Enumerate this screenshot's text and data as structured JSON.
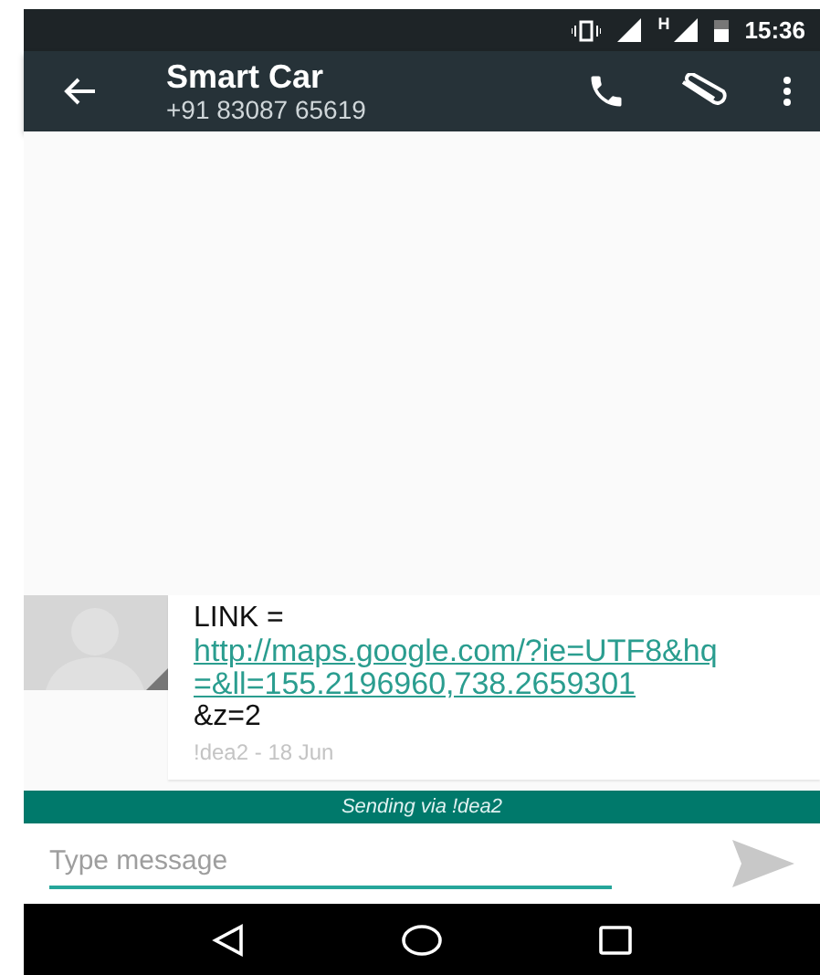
{
  "status_bar": {
    "network_type": "H",
    "time": "15:36"
  },
  "app_bar": {
    "title": "Smart Car",
    "subtitle": "+91 83087 65619"
  },
  "messages": [
    {
      "lines": [
        {
          "kind": "text",
          "text": "LINK ="
        },
        {
          "kind": "link",
          "text": "http://maps.google.com/?ie=UTF8&hq=&ll=155.2196960,738.2659301"
        },
        {
          "kind": "text",
          "text": "&z=2"
        }
      ],
      "meta": "!dea2 - 18 Jun"
    }
  ],
  "sending_banner": "Sending via !dea2",
  "composer": {
    "placeholder": "Type message"
  }
}
